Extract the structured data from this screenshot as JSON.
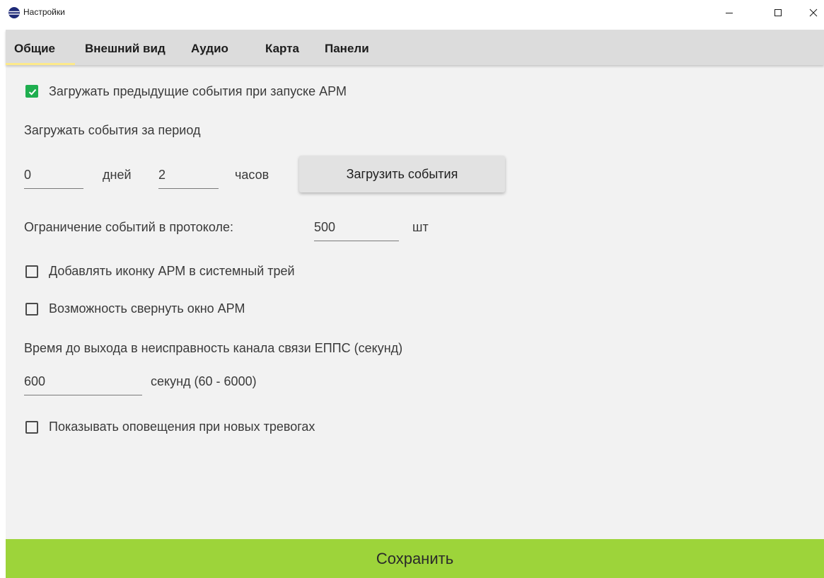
{
  "window": {
    "title": "Настройки",
    "app_icon": "globe-app-icon",
    "controls": [
      "minimize-icon",
      "maximize-icon",
      "close-icon"
    ]
  },
  "tabs": [
    {
      "label": "Общие",
      "active": true
    },
    {
      "label": "Внешний вид",
      "active": false
    },
    {
      "label": "Аудио",
      "active": false
    },
    {
      "label": "Карта",
      "active": false
    },
    {
      "label": "Панели",
      "active": false
    }
  ],
  "general": {
    "load_previous": {
      "label": "Загружать предыдущие события при запуске АРМ",
      "checked": true
    },
    "load_period_label": "Загружать события за период",
    "days": {
      "value": "0",
      "unit": "дней"
    },
    "hours": {
      "value": "2",
      "unit": "часов"
    },
    "load_button": "Загрузить события",
    "limit": {
      "label": "Ограничение событий в протоколе:",
      "value": "500",
      "unit": "шт"
    },
    "tray_icon": {
      "label": "Добавлять иконку АРМ в системный трей",
      "checked": false
    },
    "minimize": {
      "label": "Возможность свернуть окно АРМ",
      "checked": false
    },
    "timeout_label": "Время до выхода в неисправность канала связи ЕППС (секунд)",
    "timeout": {
      "value": "600",
      "unit": "секунд (60 - 6000)"
    },
    "notifications": {
      "label": "Показывать оповещения при новых тревогах",
      "checked": false
    }
  },
  "save_button": "Сохранить",
  "colors": {
    "checkbox_checked": "#1fae4f",
    "save_button": "#9dd43a",
    "tab_underline": "#fde98a",
    "tab_bar": "#dcdcdc"
  }
}
